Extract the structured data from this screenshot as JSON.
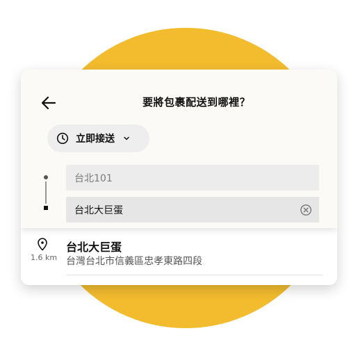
{
  "colors": {
    "accent_circle": "#f3bc2f",
    "card_background": "#fbfaf6",
    "input_background": "#ececec",
    "text_primary": "#111111",
    "text_secondary": "#555555"
  },
  "header": {
    "title": "要將包裹配送到哪裡？",
    "back_icon": "arrow-left-icon"
  },
  "schedule": {
    "icon": "clock-icon",
    "label": "立即接送",
    "dropdown_icon": "chevron-down-icon"
  },
  "route": {
    "pickup_value": "台北101",
    "dropoff_value": "台北大巨蛋",
    "clear_icon": "clear-circle-x-icon"
  },
  "results": [
    {
      "icon": "location-pin-icon",
      "distance": "1.6 km",
      "name": "台北大巨蛋",
      "address": "台灣台北市信義區忠孝東路四段"
    }
  ]
}
